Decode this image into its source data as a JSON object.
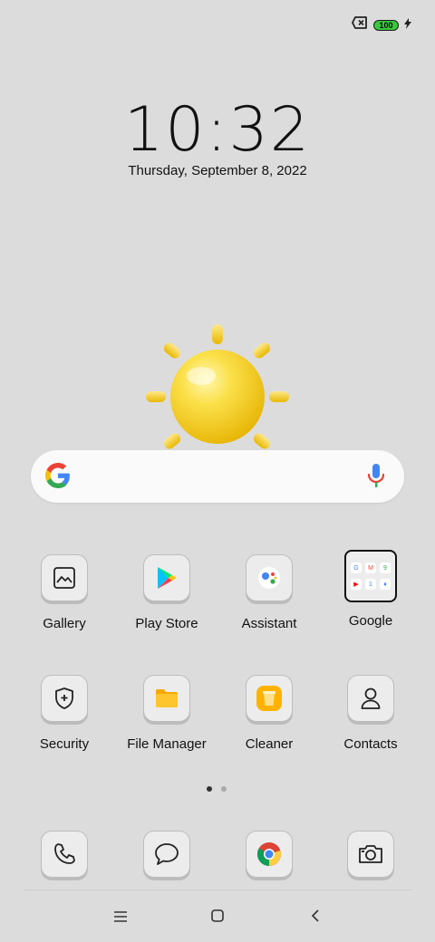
{
  "status_bar": {
    "no_sim_icon": "no-sim-icon",
    "battery_level": "100",
    "charging_icon": "bolt-icon"
  },
  "clock": {
    "time": "10:32",
    "date": "Thursday, September 8, 2022"
  },
  "weather_widget": {
    "icon": "sun-icon"
  },
  "search_bar": {
    "logo": "google-g-icon",
    "mic": "mic-icon"
  },
  "apps": [
    {
      "label": "Gallery",
      "icon": "gallery-icon"
    },
    {
      "label": "Play Store",
      "icon": "play-store-icon"
    },
    {
      "label": "Assistant",
      "icon": "assistant-icon"
    },
    {
      "label": "Google",
      "icon": "folder-icon"
    },
    {
      "label": "Security",
      "icon": "shield-icon"
    },
    {
      "label": "File Manager",
      "icon": "folder-file-icon"
    },
    {
      "label": "Cleaner",
      "icon": "trash-icon"
    },
    {
      "label": "Contacts",
      "icon": "contacts-icon"
    }
  ],
  "google_folder_contents": [
    "G",
    "M",
    "9",
    "▶",
    "1",
    "♦"
  ],
  "page_indicator": {
    "count": 2,
    "active": 1
  },
  "dock": [
    "phone-icon",
    "messages-icon",
    "chrome-icon",
    "camera-icon"
  ],
  "nav_bar": [
    "menu-icon",
    "home-icon",
    "back-icon"
  ],
  "colors": {
    "background": "#dcdcdc",
    "battery": "#39c93e",
    "accent_yellow": "#f6c400"
  }
}
